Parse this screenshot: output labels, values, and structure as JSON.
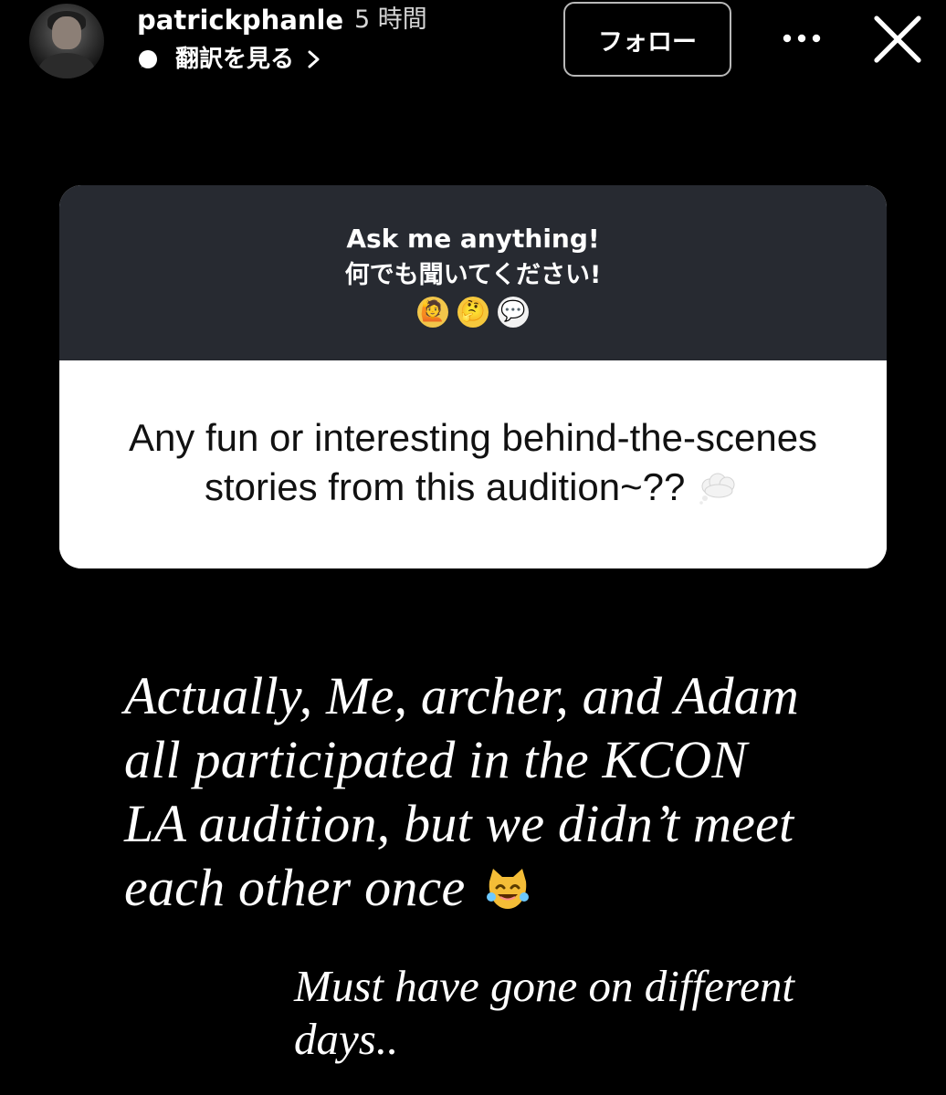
{
  "header": {
    "username": "patrickphanle",
    "timestamp": "5 時間",
    "translate_label": "翻訳を見る",
    "follow_label": "フォロー"
  },
  "question_sticker": {
    "prompt_en": "Ask me anything!",
    "prompt_ja": "何でも聞いてください!",
    "prompt_emojis": [
      "🙋",
      "🤔",
      "💬"
    ],
    "question_text": "Any fun or interesting behind-the-scenes stories from this audition~??"
  },
  "answer": {
    "main_text": "Actually, Me, archer, and Adam all participated in the KCON LA audition, but we didn’t meet each other once",
    "secondary_text": "Must have gone on different days.."
  },
  "icons": {
    "avatar": "avatar-photo",
    "translate": "speech-bubble-icon",
    "chevron": "chevron-right-icon",
    "more": "more-horizontal-icon",
    "close": "close-icon",
    "thought": "thought-bubble-icon",
    "laugh": "laughing-cat-icon"
  },
  "colors": {
    "background": "#000000",
    "header_card": "#272a31",
    "question_body": "#ffffff",
    "text_primary": "#ffffff",
    "question_text": "#111111",
    "follow_border": "#b8b8b8"
  }
}
